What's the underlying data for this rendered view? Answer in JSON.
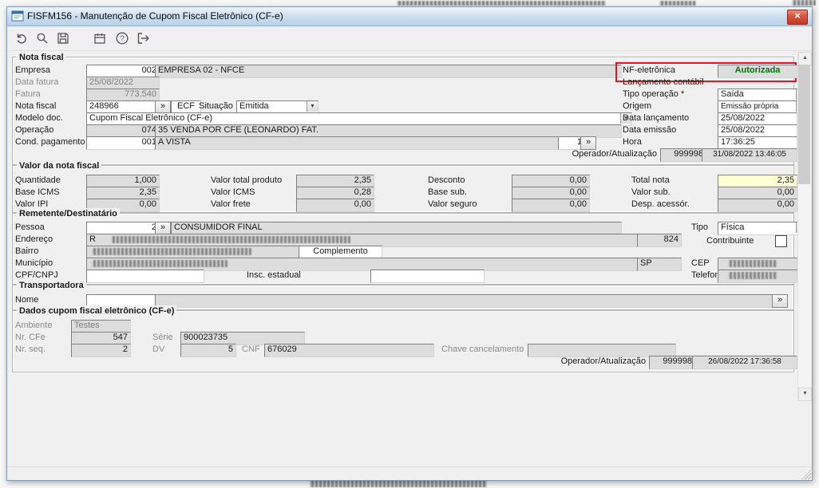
{
  "window": {
    "title": "FISFM156 - Manutenção de Cupom Fiscal Eletrônico (CF-e)"
  },
  "accent_colors": {
    "authorized_green": "#007800",
    "alert_red": "#e81123",
    "total_yellow": "#ffffd6"
  },
  "toolbar": {
    "icons": [
      "refresh",
      "search",
      "save",
      "calendar",
      "help",
      "exit"
    ]
  },
  "nota_fiscal": {
    "group_title": "Nota fiscal",
    "empresa": {
      "label": "Empresa",
      "code": "002",
      "name": "EMPRESA 02 - NFCE"
    },
    "data_fatura": {
      "label": "Data fatura",
      "value": "25/08/2022"
    },
    "fatura": {
      "label": "Fatura",
      "value": "773.540"
    },
    "nota": {
      "label": "Nota fiscal",
      "value": "248966",
      "lookup": "»",
      "ecf": "ECF",
      "situacao_label": "Situação",
      "situacao": "Emitida"
    },
    "modelo_doc": {
      "label": "Modelo doc.",
      "value": "Cupom Fiscal Eletrônico (CF-e)"
    },
    "operacao": {
      "label": "Operação",
      "code": "074",
      "name": "35 VENDA POR CFE (LEONARDO) FAT."
    },
    "cond_pagamento": {
      "label": "Cond. pagamento",
      "code": "001",
      "name": "A VISTA",
      "parcela": "1",
      "lookup": "»"
    },
    "nf_eletronica": {
      "label": "NF-eletrônica",
      "value": "Autorizada"
    },
    "lancamento_contabil": {
      "label": "Lançamento contábil"
    },
    "tipo_operacao": {
      "label": "Tipo operação *",
      "value": "Saída"
    },
    "origem": {
      "label": "Origem",
      "value": "Emissão própria"
    },
    "data_lancamento": {
      "label": "Data lançamento",
      "value": "25/08/2022"
    },
    "data_emissao": {
      "label": "Data emissão",
      "value": "25/08/2022"
    },
    "hora": {
      "label": "Hora",
      "value": "17:36:25"
    },
    "operador": {
      "label": "Operador/Atualização",
      "code": "999998",
      "datetime": "31/08/2022 13:46:05"
    }
  },
  "valores": {
    "group_title": "Valor da nota fiscal",
    "quantidade": {
      "label": "Quantidade",
      "value": "1,000"
    },
    "base_icms": {
      "label": "Base ICMS",
      "value": "2,35"
    },
    "valor_ipi": {
      "label": "Valor IPI",
      "value": "0,00"
    },
    "valor_total_produto": {
      "label": "Valor total produto",
      "value": "2,35"
    },
    "valor_icms": {
      "label": "Valor ICMS",
      "value": "0,28"
    },
    "valor_frete": {
      "label": "Valor frete",
      "value": "0,00"
    },
    "desconto": {
      "label": "Desconto",
      "value": "0,00"
    },
    "base_sub": {
      "label": "Base sub.",
      "value": "0,00"
    },
    "valor_seguro": {
      "label": "Valor seguro",
      "value": "0,00"
    },
    "total_nota": {
      "label": "Total nota",
      "value": "2,35"
    },
    "valor_sub": {
      "label": "Valor sub.",
      "value": "0,00"
    },
    "desp_acessor": {
      "label": "Desp. acessór.",
      "value": "0,00"
    }
  },
  "remetente": {
    "group_title": "Remetente/Destinatário",
    "pessoa": {
      "label": "Pessoa",
      "code": "2",
      "lookup": "»",
      "name": "CONSUMIDOR FINAL"
    },
    "tipo": {
      "label": "Tipo",
      "value": "Física"
    },
    "endereco": {
      "label": "Endereço",
      "prefix": "R",
      "numero": "824"
    },
    "contribuinte": {
      "label": "Contribuinte",
      "checked": false
    },
    "bairro": {
      "label": "Bairro"
    },
    "complemento": {
      "label": "Complemento"
    },
    "municipio": {
      "label": "Município",
      "uf": "SP"
    },
    "cep": {
      "label": "CEP"
    },
    "cpf_cnpj": {
      "label": "CPF/CNPJ",
      "value": ""
    },
    "insc_estadual": {
      "label": "Insc. estadual",
      "value": ""
    },
    "telefone": {
      "label": "Telefone"
    }
  },
  "transportadora": {
    "group_title": "Transportadora",
    "nome": {
      "label": "Nome",
      "value": ""
    },
    "lookup": "»"
  },
  "dados_cfe": {
    "group_title": "Dados cupom fiscal eletrônico (CF-e)",
    "ambiente": {
      "label": "Ambiente",
      "value": "Testes"
    },
    "nr_cfe": {
      "label": "Nr. CFe",
      "value": "547"
    },
    "nr_seq": {
      "label": "Nr. seq.",
      "value": "2"
    },
    "serie": {
      "label": "Série",
      "value": "900023735"
    },
    "dv": {
      "label": "DV",
      "value": "5"
    },
    "cnf": {
      "label": "CNF",
      "value": "676029"
    },
    "chave_cancelamento": {
      "label": "Chave cancelamento",
      "value": ""
    },
    "operador": {
      "label": "Operador/Atualização",
      "code": "999998",
      "datetime": "26/08/2022 17:36:58"
    }
  }
}
